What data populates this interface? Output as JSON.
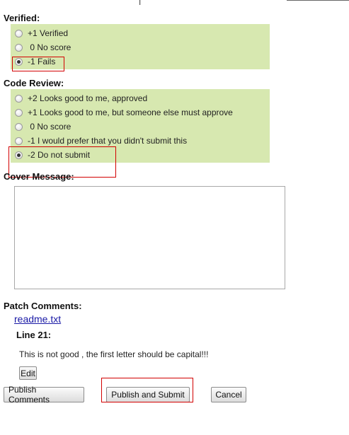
{
  "verified": {
    "label": "Verified:",
    "options": [
      {
        "label": "+1 Verified",
        "checked": false
      },
      {
        "label": " 0 No score",
        "checked": false
      },
      {
        "label": "-1 Fails",
        "checked": true
      }
    ]
  },
  "code_review": {
    "label": "Code Review:",
    "options": [
      {
        "label": "+2 Looks good to me, approved",
        "checked": false
      },
      {
        "label": "+1 Looks good to me, but someone else must approve",
        "checked": false
      },
      {
        "label": " 0 No score",
        "checked": false
      },
      {
        "label": "-1 I would prefer that you didn't submit this",
        "checked": false
      },
      {
        "label": "-2 Do not submit",
        "checked": true
      }
    ]
  },
  "cover_message": {
    "label": "Cover Message:",
    "value": ""
  },
  "patch_comments": {
    "label": "Patch Comments:",
    "file_name": "readme.txt",
    "line_label": "Line 21:",
    "comment_text": "This is not good , the first letter should be capital!!!",
    "edit_label": "Edit"
  },
  "actions": {
    "publish_comments": "Publish Comments",
    "publish_and_submit": "Publish and Submit",
    "cancel": "Cancel"
  },
  "colors": {
    "option_background": "#d7e8b0",
    "highlight_border": "#d20000",
    "link": "#1a1aa6"
  }
}
